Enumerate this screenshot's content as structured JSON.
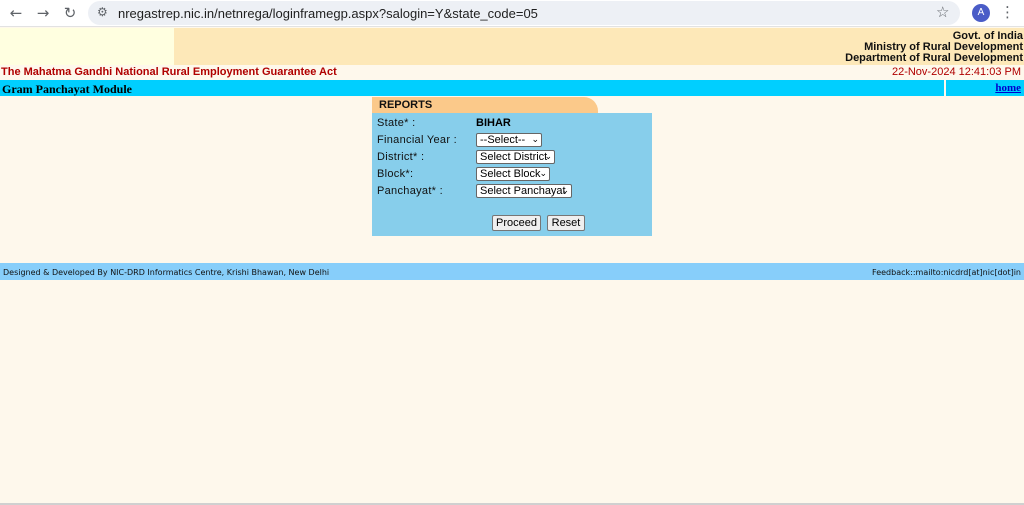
{
  "browser": {
    "url": "nregastrep.nic.in/netnrega/loginframegp.aspx?salogin=Y&state_code=05",
    "avatar_letter": "A",
    "icons": {
      "back": "back-arrow-icon",
      "forward": "forward-arrow-icon",
      "reload": "reload-icon",
      "site_info": "tune-icon",
      "bookmark": "star-icon",
      "menu": "kebab-icon"
    }
  },
  "header": {
    "gov": "Govt. of India",
    "ministry": "Ministry of Rural Development",
    "department": "Department of Rural Development",
    "act": "The Mahatma Gandhi National Rural Employment Guarantee Act",
    "datetime": "22-Nov-2024 12:41:03 PM"
  },
  "module": {
    "title": "Gram Panchayat Module",
    "home": "home"
  },
  "reports": {
    "heading": "REPORTS",
    "state_label": "State* :",
    "state_value": "BIHAR",
    "fy_label": "Financial Year :",
    "fy_value": "--Select--",
    "district_label": "District* :",
    "district_value": "Select District",
    "block_label": "Block*:",
    "block_value": "Select Block",
    "panchayat_label": "Panchayat* :",
    "panchayat_value": "Select Panchayat",
    "proceed": "Proceed",
    "reset": "Reset"
  },
  "footer": {
    "left": "Designed & Developed By NIC-DRD Informatics Centre, Krishi Bhawan, New Delhi",
    "right": "Feedback::mailto:nicdrd[at]nic[dot]in"
  },
  "colors": {
    "module_bar": "#00cfff",
    "footer_bar": "#87cefa",
    "panel": "#87ceeb",
    "tab": "#fbc98a",
    "act_text": "#b00000"
  }
}
